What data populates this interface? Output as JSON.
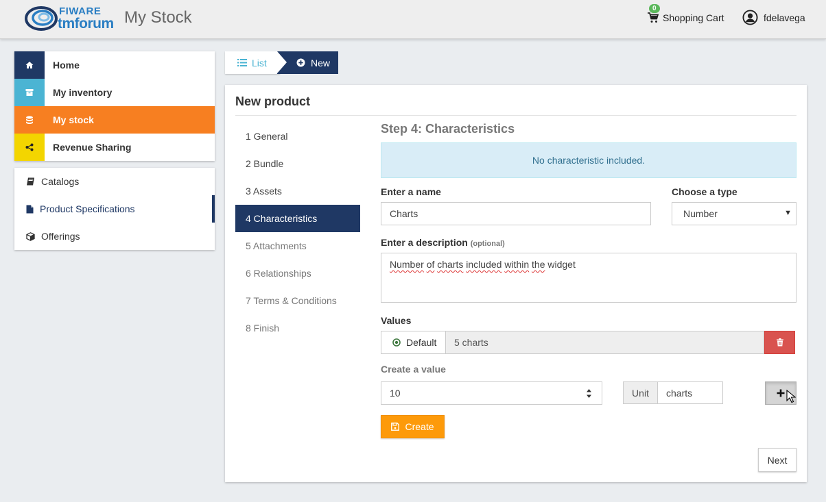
{
  "header": {
    "logo_top": "FIWARE",
    "logo_bottom": "tmforum",
    "app_title": "My Stock",
    "cart_count": "0",
    "cart_label": "Shopping Cart",
    "username": "fdelavega"
  },
  "sidebar": {
    "main": [
      {
        "label": "Home",
        "icon": "home-icon",
        "color": "#1f3864"
      },
      {
        "label": "My inventory",
        "icon": "archive-icon",
        "color": "#4bb4d3"
      },
      {
        "label": "My stock",
        "icon": "database-icon",
        "color": "#f77f21"
      },
      {
        "label": "Revenue Sharing",
        "icon": "share-icon",
        "color": "#f3d500"
      }
    ],
    "sub": [
      {
        "label": "Catalogs",
        "icon": "book-icon"
      },
      {
        "label": "Product Specifications",
        "icon": "file-icon"
      },
      {
        "label": "Offerings",
        "icon": "cube-icon"
      }
    ]
  },
  "breadcrumb": {
    "list_label": "List",
    "new_label": "New"
  },
  "panel": {
    "title": "New product",
    "steps": [
      "1 General",
      "2 Bundle",
      "3 Assets",
      "4 Characteristics",
      "5 Attachments",
      "6 Relationships",
      "7 Terms & Conditions",
      "8 Finish"
    ],
    "active_step": 4
  },
  "form": {
    "step_title": "Step 4: Characteristics",
    "info_message": "No characteristic included.",
    "name_label": "Enter a name",
    "name_value": "Charts",
    "type_label": "Choose a type",
    "type_value": "Number",
    "desc_label": "Enter a description",
    "desc_optional": "(optional)",
    "desc_words": [
      "Number",
      "of",
      "charts",
      "included",
      "within",
      "the",
      "widget"
    ],
    "values_label": "Values",
    "default_label": "Default",
    "value_item": "5 charts",
    "create_value_label": "Create a value",
    "value_input": "10",
    "unit_label": "Unit",
    "unit_value": "charts",
    "create_button": "Create",
    "next_button": "Next"
  },
  "colors": {
    "primary_dark": "#1f3864",
    "accent_cyan": "#4bb4d3",
    "accent_orange": "#f77f21",
    "accent_yellow": "#f3d500",
    "create_orange": "#fd9a0a",
    "danger": "#d9534f",
    "info_bg": "#d9edf7",
    "info_text": "#31708f"
  }
}
